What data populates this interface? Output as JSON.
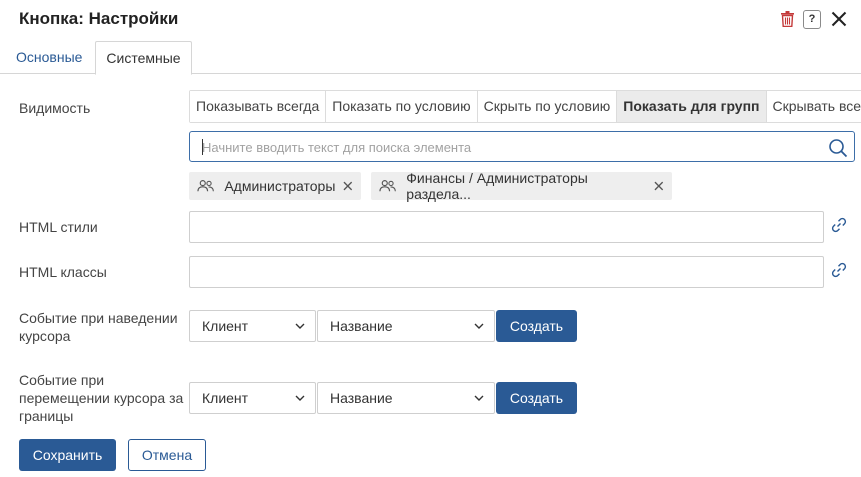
{
  "dialog": {
    "title": "Кнопка: Настройки"
  },
  "tabs": [
    {
      "label": "Основные"
    },
    {
      "label": "Системные"
    }
  ],
  "visibility": {
    "label": "Видимость",
    "options": [
      {
        "label": "Показывать всегда"
      },
      {
        "label": "Показать по условию"
      },
      {
        "label": "Скрыть по условию"
      },
      {
        "label": "Показать для групп"
      },
      {
        "label": "Скрывать всегда"
      }
    ],
    "selected": "Показать для групп",
    "search_placeholder": "Начните вводить текст для поиска элемента",
    "search_value": "",
    "groups": [
      {
        "label": "Администраторы"
      },
      {
        "label": "Финансы / Администраторы раздела..."
      }
    ]
  },
  "html_styles": {
    "label": "HTML стили",
    "value": ""
  },
  "html_classes": {
    "label": "HTML классы",
    "value": ""
  },
  "hover_event": {
    "label": "Событие при наведении курсора",
    "side": "Клиент",
    "name": "Название",
    "create_label": "Создать"
  },
  "leave_event": {
    "label": "Событие при перемещении курсора за границы",
    "side": "Клиент",
    "name": "Название",
    "create_label": "Создать"
  },
  "footer": {
    "save_label": "Сохранить",
    "cancel_label": "Отмена"
  },
  "colors": {
    "accent": "#2a5a95",
    "danger": "#c43a3a",
    "selected_segment": "#ebebeb"
  },
  "icons": [
    "trash-icon",
    "help-icon",
    "close-icon",
    "search-icon",
    "group-icon",
    "remove-icon",
    "link-icon",
    "chevron-down-icon"
  ]
}
